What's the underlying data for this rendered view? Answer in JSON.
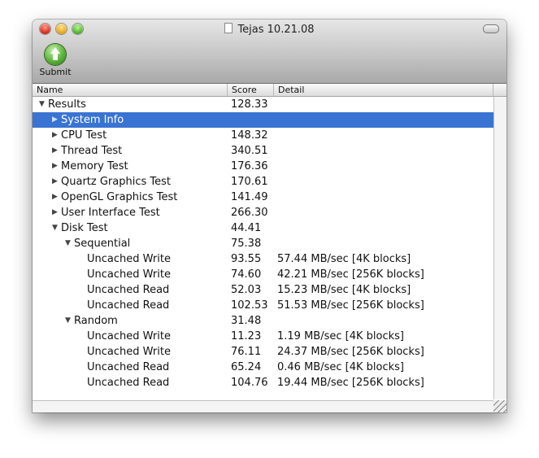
{
  "window": {
    "title": "Tejas 10.21.08"
  },
  "toolbar": {
    "submit_label": "Submit"
  },
  "columns": {
    "name": "Name",
    "score": "Score",
    "detail": "Detail"
  },
  "rows": [
    {
      "name": "Results",
      "score": "128.33",
      "detail": "",
      "indent": 0,
      "toggle": "open",
      "selected": false
    },
    {
      "name": "System Info",
      "score": "",
      "detail": "",
      "indent": 1,
      "toggle": "closed",
      "selected": true
    },
    {
      "name": "CPU Test",
      "score": "148.32",
      "detail": "",
      "indent": 1,
      "toggle": "closed",
      "selected": false
    },
    {
      "name": "Thread Test",
      "score": "340.51",
      "detail": "",
      "indent": 1,
      "toggle": "closed",
      "selected": false
    },
    {
      "name": "Memory Test",
      "score": "176.36",
      "detail": "",
      "indent": 1,
      "toggle": "closed",
      "selected": false
    },
    {
      "name": "Quartz Graphics Test",
      "score": "170.61",
      "detail": "",
      "indent": 1,
      "toggle": "closed",
      "selected": false
    },
    {
      "name": "OpenGL Graphics Test",
      "score": "141.49",
      "detail": "",
      "indent": 1,
      "toggle": "closed",
      "selected": false
    },
    {
      "name": "User Interface Test",
      "score": "266.30",
      "detail": "",
      "indent": 1,
      "toggle": "closed",
      "selected": false
    },
    {
      "name": "Disk Test",
      "score": "44.41",
      "detail": "",
      "indent": 1,
      "toggle": "open",
      "selected": false
    },
    {
      "name": "Sequential",
      "score": "75.38",
      "detail": "",
      "indent": 2,
      "toggle": "open",
      "selected": false
    },
    {
      "name": "Uncached Write",
      "score": "93.55",
      "detail": "57.44 MB/sec [4K blocks]",
      "indent": 3,
      "toggle": "none",
      "selected": false
    },
    {
      "name": "Uncached Write",
      "score": "74.60",
      "detail": "42.21 MB/sec [256K blocks]",
      "indent": 3,
      "toggle": "none",
      "selected": false
    },
    {
      "name": "Uncached Read",
      "score": "52.03",
      "detail": "15.23 MB/sec [4K blocks]",
      "indent": 3,
      "toggle": "none",
      "selected": false
    },
    {
      "name": "Uncached Read",
      "score": "102.53",
      "detail": "51.53 MB/sec [256K blocks]",
      "indent": 3,
      "toggle": "none",
      "selected": false
    },
    {
      "name": "Random",
      "score": "31.48",
      "detail": "",
      "indent": 2,
      "toggle": "open",
      "selected": false
    },
    {
      "name": "Uncached Write",
      "score": "11.23",
      "detail": "1.19 MB/sec [4K blocks]",
      "indent": 3,
      "toggle": "none",
      "selected": false
    },
    {
      "name": "Uncached Write",
      "score": "76.11",
      "detail": "24.37 MB/sec [256K blocks]",
      "indent": 3,
      "toggle": "none",
      "selected": false
    },
    {
      "name": "Uncached Read",
      "score": "65.24",
      "detail": "0.46 MB/sec [4K blocks]",
      "indent": 3,
      "toggle": "none",
      "selected": false
    },
    {
      "name": "Uncached Read",
      "score": "104.76",
      "detail": "19.44 MB/sec [256K blocks]",
      "indent": 3,
      "toggle": "none",
      "selected": false
    }
  ]
}
